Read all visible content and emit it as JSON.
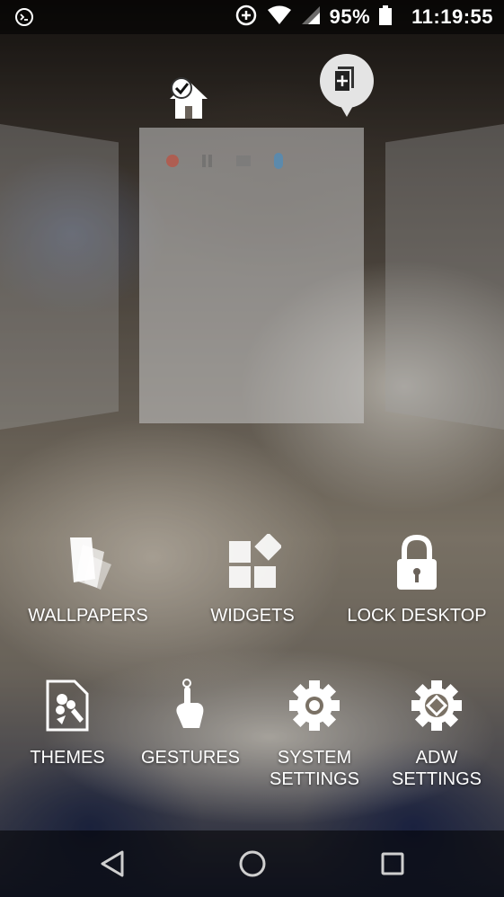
{
  "status_bar": {
    "left_icon": "terminal-icon",
    "sync_icon": "sync-plus-icon",
    "wifi_icon": "wifi-icon",
    "signal_icon": "cell-signal-icon",
    "battery_percent": "95%",
    "battery_icon": "battery-icon",
    "time": "11:19:55"
  },
  "top_icons": {
    "home": "home-check-icon",
    "add_page": "add-page-icon"
  },
  "menu": {
    "row1": [
      {
        "label": "WALLPAPERS",
        "icon": "wallpapers-icon"
      },
      {
        "label": "WIDGETS",
        "icon": "widgets-icon"
      },
      {
        "label": "LOCK DESKTOP",
        "icon": "lock-icon"
      }
    ],
    "row2": [
      {
        "label": "THEMES",
        "icon": "themes-icon"
      },
      {
        "label": "GESTURES",
        "icon": "gestures-icon"
      },
      {
        "label": "SYSTEM\nSETTINGS",
        "icon": "system-settings-icon"
      },
      {
        "label": "ADW\nSETTINGS",
        "icon": "adw-settings-icon"
      }
    ]
  },
  "nav": {
    "back": "back-icon",
    "home": "home-circle-icon",
    "recents": "recents-icon"
  }
}
